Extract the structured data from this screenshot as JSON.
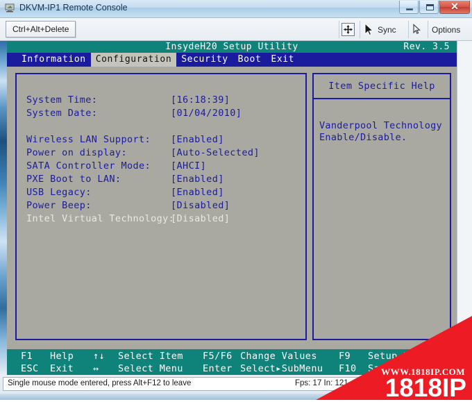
{
  "window": {
    "title": "DKVM-IP1 Remote Console",
    "icon": "remote-console-icon",
    "buttons": {
      "minimize": "minimize-icon",
      "maximize": "maximize-icon",
      "close": "✕"
    }
  },
  "toolbar": {
    "cad_label": "Ctrl+Alt+Delete",
    "fit_icon": "fit-to-window-icon",
    "sync_icon": "mouse-pointer-icon",
    "sync_label": "Sync",
    "pointer_icon": "mouse-pointer-small-icon",
    "options_label": "Options"
  },
  "bios": {
    "title": "InsydeH20 Setup Utility",
    "revision": "Rev. 3.5",
    "tabs": [
      {
        "label": "Information",
        "active": false
      },
      {
        "label": "Configuration",
        "active": true
      },
      {
        "label": "Security",
        "active": false
      },
      {
        "label": "Boot",
        "active": false
      },
      {
        "label": "Exit",
        "active": false
      }
    ],
    "settings": [
      {
        "label": "System Time:",
        "value": "[16:18:39]",
        "selected": false
      },
      {
        "label": "System Date:",
        "value": "[01/04/2010]",
        "selected": false
      },
      {
        "spacer": true
      },
      {
        "label": "Wireless LAN Support:",
        "value": "[Enabled]",
        "selected": false
      },
      {
        "label": "Power on display:",
        "value": "[Auto-Selected]",
        "selected": false
      },
      {
        "label": "SATA Controller Mode:",
        "value": "[AHCI]",
        "selected": false
      },
      {
        "label": "PXE Boot to LAN:",
        "value": "[Enabled]",
        "selected": false
      },
      {
        "label": "USB Legacy:",
        "value": "[Enabled]",
        "selected": false
      },
      {
        "label": "Power Beep:",
        "value": "[Disabled]",
        "selected": false
      },
      {
        "label": "Intel Virtual Technology:",
        "value": "[Disabled]",
        "selected": true
      }
    ],
    "help": {
      "title": "Item Specific Help",
      "text": "Vanderpool Technology Enable/Disable."
    },
    "footer": {
      "row1": [
        {
          "key": "F1",
          "action": "Help"
        },
        {
          "key": "↑↓",
          "action": "Select Item"
        },
        {
          "key": "F5/F6",
          "action": "Change Values"
        },
        {
          "key": "F9",
          "action": "Setup Defaults"
        }
      ],
      "row2": [
        {
          "key": "ESC",
          "action": "Exit"
        },
        {
          "key": "↔",
          "action": "Select Menu"
        },
        {
          "key": "Enter",
          "action": "Select▸SubMenu"
        },
        {
          "key": "F10",
          "action": "Save and Exit"
        }
      ]
    }
  },
  "status": {
    "message": "Single mouse mode entered, press Alt+F12 to leave",
    "stats": "Fps: 17 In: 121"
  },
  "watermark": {
    "url": "WWW.1818IP.COM",
    "brand": "1818IP",
    "color": "#ed1c24"
  },
  "colors": {
    "bios_teal": "#0f8279",
    "bios_navy": "#1b1b9e",
    "bios_grey": "#a9a9a1",
    "close_red": "#c13f32"
  }
}
